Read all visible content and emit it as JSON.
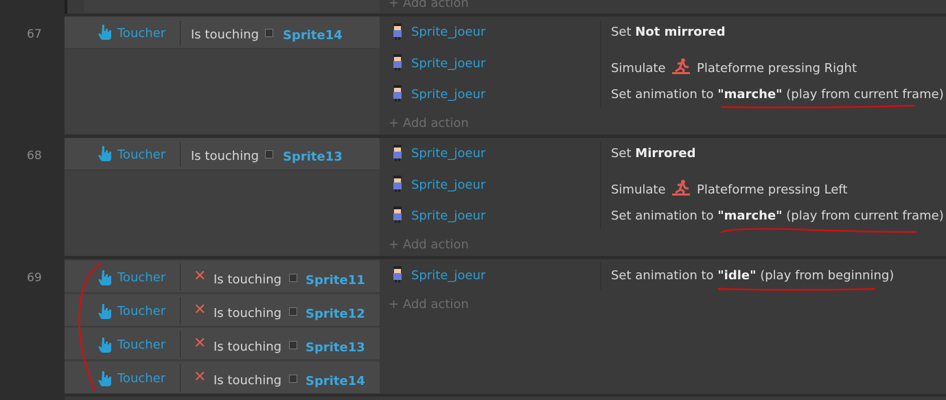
{
  "top_partial": {
    "add_action": "Add action"
  },
  "events": [
    {
      "line": "67",
      "conditions": [
        {
          "object": "Toucher",
          "text": "Is touching",
          "sprite": "Sprite14",
          "inverted": false
        }
      ],
      "actions": [
        {
          "object": "Sprite_joeur",
          "pre": "Set",
          "bold": "Not mirrored",
          "post": ""
        },
        {
          "object": "Sprite_joeur",
          "pre": "Simulate",
          "bold": "",
          "post": "Plateforme pressing Right",
          "icon": "running-icon"
        },
        {
          "object": "Sprite_joeur",
          "pre": "Set animation to",
          "bold": "\"marche\"",
          "post": "(play from current frame)"
        }
      ],
      "add_action": "Add action"
    },
    {
      "line": "68",
      "conditions": [
        {
          "object": "Toucher",
          "text": "Is touching",
          "sprite": "Sprite13",
          "inverted": false
        }
      ],
      "actions": [
        {
          "object": "Sprite_joeur",
          "pre": "Set",
          "bold": "Mirrored",
          "post": ""
        },
        {
          "object": "Sprite_joeur",
          "pre": "Simulate",
          "bold": "",
          "post": "Plateforme pressing Left",
          "icon": "running-icon"
        },
        {
          "object": "Sprite_joeur",
          "pre": "Set animation to",
          "bold": "\"marche\"",
          "post": "(play from current frame)"
        }
      ],
      "add_action": "Add action"
    },
    {
      "line": "69",
      "conditions": [
        {
          "object": "Toucher",
          "text": "Is touching",
          "sprite": "Sprite11",
          "inverted": true
        },
        {
          "object": "Toucher",
          "text": "Is touching",
          "sprite": "Sprite12",
          "inverted": true
        },
        {
          "object": "Toucher",
          "text": "Is touching",
          "sprite": "Sprite13",
          "inverted": true
        },
        {
          "object": "Toucher",
          "text": "Is touching",
          "sprite": "Sprite14",
          "inverted": true
        }
      ],
      "actions": [
        {
          "object": "Sprite_joeur",
          "pre": "Set animation to",
          "bold": "\"idle\"",
          "post": "(play from beginning)"
        }
      ],
      "add_action": "Add action"
    }
  ],
  "colors": {
    "annotation": "#d01010",
    "object": "#2a9fd6",
    "invert": "#e0604f"
  }
}
